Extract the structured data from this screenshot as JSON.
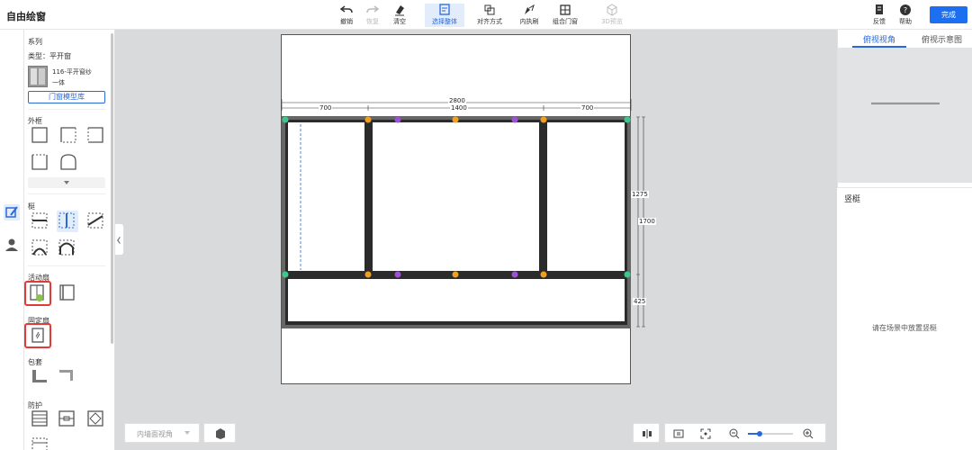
{
  "app": {
    "title": "自由绘窗"
  },
  "toolbar": {
    "undo": "撤销",
    "redo": "恢复",
    "clear": "清空",
    "select_all": "选择整体",
    "align": "对齐方式",
    "inner_flip": "内执刷",
    "combine_door": "组合门窗",
    "view_3d": "3D预览",
    "feedback": "反馈",
    "help": "帮助",
    "done": "完成"
  },
  "left_panel": {
    "series_title": "系列",
    "type_label": "类型：平开窗",
    "model_name_line1": "116-平开窗纱",
    "model_name_line2": "一体",
    "library_button": "门窗模型库",
    "outer_frame_title": "外框",
    "mullion_title": "梃",
    "active_sash_title": "活动扇",
    "fixed_sash_title": "固定扇",
    "cover_title": "包套",
    "guard_title": "防护"
  },
  "canvas": {
    "dimensions": {
      "total_width": "2800",
      "left_width": "700",
      "middle_width": "1400",
      "right_width": "700",
      "upper_height": "1275",
      "total_height": "1700",
      "lower_height": "425"
    }
  },
  "bottom": {
    "view_select": "内墙面视角",
    "zoom_level_fraction": 0.25
  },
  "right_panel": {
    "tab_top_view": "俯视视角",
    "tab_top_diagram": "俯视示意图",
    "section_title": "竖梃",
    "empty_hint": "请在场景中放置竖梃"
  },
  "colors": {
    "accent": "#1d6ff2",
    "frame": "#2b2b2b",
    "frame_outer": "#666666",
    "node_green": "#3cc88c",
    "node_orange": "#f0a020",
    "node_purple": "#a050d8",
    "highlight_red": "#e53935"
  }
}
